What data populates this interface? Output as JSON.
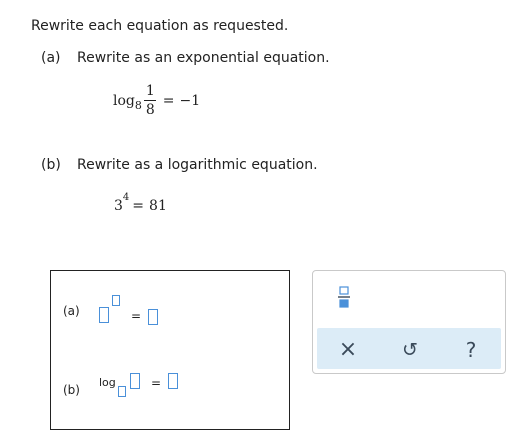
{
  "instructions": "Rewrite each equation as requested.",
  "part_a": {
    "label": "(a)",
    "prompt": "Rewrite as an exponential equation.",
    "log_word": "log",
    "base": "8",
    "frac_num": "1",
    "frac_den": "8",
    "equals": "=",
    "rhs": "−1"
  },
  "part_b": {
    "label": "(b)",
    "prompt": "Rewrite as a logarithmic equation.",
    "base": "3",
    "exponent": "4",
    "equals": "=",
    "rhs": "81"
  },
  "answer": {
    "a_label": "(a)",
    "a_equals": "=",
    "b_label": "(b)",
    "b_log": "log",
    "b_equals": "="
  },
  "toolbar": {
    "clear_glyph": "×",
    "undo_glyph": "↺",
    "help_glyph": "?"
  },
  "colors": {
    "accent": "#4a90d9",
    "toolbar_bg": "#dcecf7",
    "icon": "#3a4a5a"
  }
}
